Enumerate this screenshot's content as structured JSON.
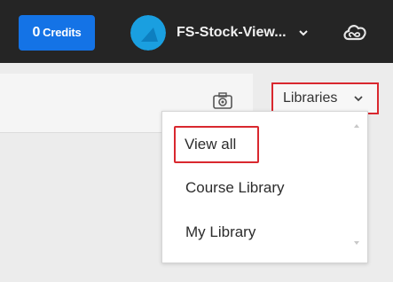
{
  "header": {
    "credits_count": "0",
    "credits_label": "Credits",
    "project_name": "FS-Stock-View...",
    "colors": {
      "bar": "#252525",
      "credits_button": "#1473e6",
      "avatar": "#1a9fe0"
    }
  },
  "toolbar": {
    "libraries_label": "Libraries",
    "icons": [
      "camera-icon",
      "chevron-down-icon",
      "creative-cloud-icon"
    ]
  },
  "dropdown": {
    "items": [
      {
        "label": "View all"
      },
      {
        "label": "Course Library"
      },
      {
        "label": "My Library"
      }
    ]
  },
  "highlight_color": "#d9282f"
}
